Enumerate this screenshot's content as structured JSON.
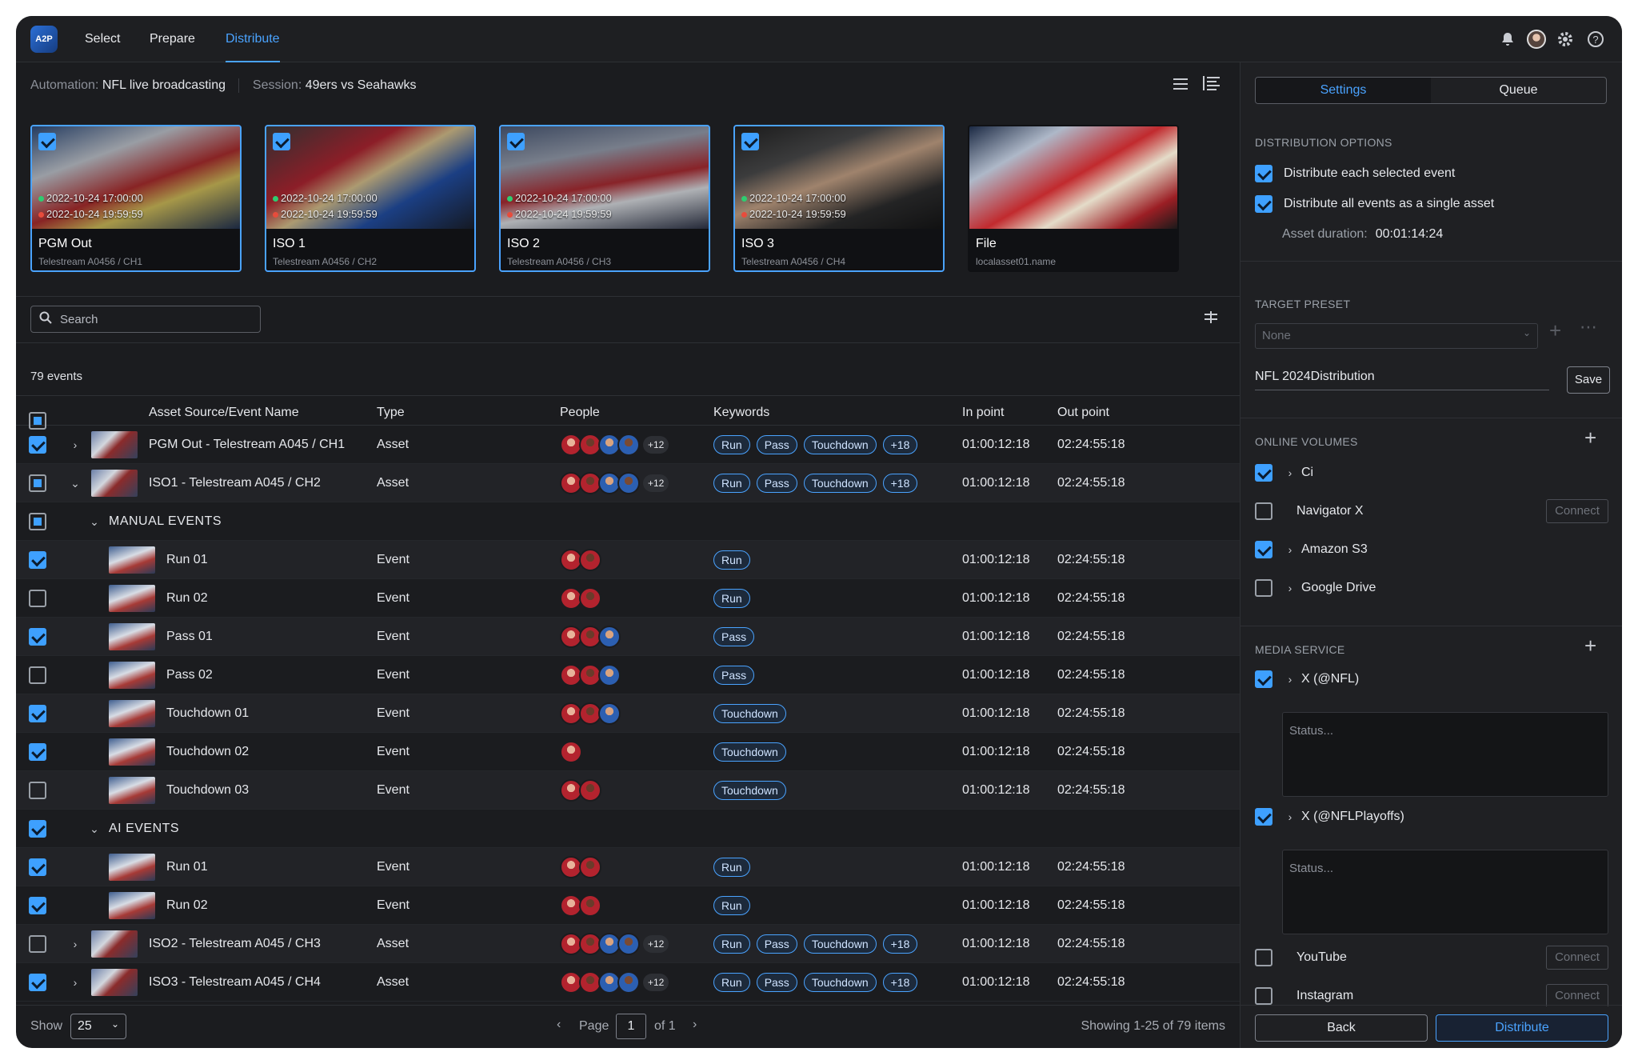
{
  "app": {
    "logo": "A2P",
    "tabs": [
      "Select",
      "Prepare",
      "Distribute"
    ],
    "active_tab": "Distribute"
  },
  "info": {
    "automation_label": "Automation:",
    "automation_value": "NFL live broadcasting",
    "session_label": "Session:",
    "session_value": "49ers vs Seahawks"
  },
  "cards": [
    {
      "name": "PGM Out",
      "sub": "Telestream A0456 / CH1",
      "start": "2022-10-24 17:00:00",
      "end": "2022-10-24 19:59:59",
      "checked": true
    },
    {
      "name": "ISO 1",
      "sub": "Telestream A0456 / CH2",
      "start": "2022-10-24 17:00:00",
      "end": "2022-10-24 19:59:59",
      "checked": true
    },
    {
      "name": "ISO 2",
      "sub": "Telestream A0456 / CH3",
      "start": "2022-10-24 17:00:00",
      "end": "2022-10-24 19:59:59",
      "checked": true
    },
    {
      "name": "ISO 3",
      "sub": "Telestream A0456 / CH4",
      "start": "2022-10-24 17:00:00",
      "end": "2022-10-24 19:59:59",
      "checked": true
    },
    {
      "name": "File",
      "sub": "localasset01.name",
      "start": "",
      "end": "",
      "checked": false
    }
  ],
  "search": {
    "placeholder": "Search"
  },
  "events_count": "79 events",
  "table": {
    "headers": [
      "Asset Source/Event Name",
      "Type",
      "People",
      "Keywords",
      "In point",
      "Out point"
    ],
    "rows": [
      {
        "kind": "asset",
        "checked": "on",
        "caret": "›",
        "name": "PGM Out - Telestream A045 / CH1",
        "type": "Asset",
        "people": 4,
        "more": "+12",
        "tags": [
          "Run",
          "Pass",
          "Touchdown",
          "+18"
        ],
        "in": "01:00:12:18",
        "out": "02:24:55:18"
      },
      {
        "kind": "asset",
        "checked": "ind",
        "caret": "⌄",
        "name": "ISO1 - Telestream A045 / CH2",
        "type": "Asset",
        "people": 4,
        "more": "+12",
        "tags": [
          "Run",
          "Pass",
          "Touchdown",
          "+18"
        ],
        "in": "01:00:12:18",
        "out": "02:24:55:18"
      },
      {
        "kind": "group",
        "checked": "ind",
        "caret": "⌄",
        "name": "MANUAL EVENTS"
      },
      {
        "kind": "event",
        "checked": "on",
        "name": "Run 01",
        "type": "Event",
        "people": 2,
        "tags": [
          "Run"
        ],
        "in": "01:00:12:18",
        "out": "02:24:55:18"
      },
      {
        "kind": "event",
        "checked": "off",
        "name": "Run 02",
        "type": "Event",
        "people": 2,
        "tags": [
          "Run"
        ],
        "in": "01:00:12:18",
        "out": "02:24:55:18"
      },
      {
        "kind": "event",
        "checked": "on",
        "name": "Pass 01",
        "type": "Event",
        "people": 3,
        "tags": [
          "Pass"
        ],
        "in": "01:00:12:18",
        "out": "02:24:55:18"
      },
      {
        "kind": "event",
        "checked": "off",
        "name": "Pass 02",
        "type": "Event",
        "people": 3,
        "tags": [
          "Pass"
        ],
        "in": "01:00:12:18",
        "out": "02:24:55:18"
      },
      {
        "kind": "event",
        "checked": "on",
        "name": "Touchdown 01",
        "type": "Event",
        "people": 3,
        "tags": [
          "Touchdown"
        ],
        "in": "01:00:12:18",
        "out": "02:24:55:18"
      },
      {
        "kind": "event",
        "checked": "on",
        "name": "Touchdown 02",
        "type": "Event",
        "people": 1,
        "tags": [
          "Touchdown"
        ],
        "in": "01:00:12:18",
        "out": "02:24:55:18"
      },
      {
        "kind": "event",
        "checked": "off",
        "name": "Touchdown 03",
        "type": "Event",
        "people": 2,
        "tags": [
          "Touchdown"
        ],
        "in": "01:00:12:18",
        "out": "02:24:55:18"
      },
      {
        "kind": "group",
        "checked": "on",
        "caret": "⌄",
        "name": "AI EVENTS"
      },
      {
        "kind": "event",
        "checked": "on",
        "name": "Run 01",
        "type": "Event",
        "people": 2,
        "tags": [
          "Run"
        ],
        "in": "01:00:12:18",
        "out": "02:24:55:18"
      },
      {
        "kind": "event",
        "checked": "on",
        "name": "Run 02",
        "type": "Event",
        "people": 2,
        "tags": [
          "Run"
        ],
        "in": "01:00:12:18",
        "out": "02:24:55:18"
      },
      {
        "kind": "asset",
        "checked": "off",
        "caret": "›",
        "name": "ISO2 - Telestream A045 / CH3",
        "type": "Asset",
        "people": 4,
        "more": "+12",
        "tags": [
          "Run",
          "Pass",
          "Touchdown",
          "+18"
        ],
        "in": "01:00:12:18",
        "out": "02:24:55:18"
      },
      {
        "kind": "asset",
        "checked": "on",
        "caret": "›",
        "name": "ISO3 - Telestream A045 / CH4",
        "type": "Asset",
        "people": 4,
        "more": "+12",
        "tags": [
          "Run",
          "Pass",
          "Touchdown",
          "+18"
        ],
        "in": "01:00:12:18",
        "out": "02:24:55:18"
      }
    ]
  },
  "footer": {
    "show_label": "Show",
    "page_size": "25",
    "page_label": "Page",
    "page": "1",
    "of": "of 1",
    "showing": "Showing 1-25 of 79 items"
  },
  "panel": {
    "tabs": [
      "Settings",
      "Queue"
    ],
    "active_tab": "Settings",
    "distribution_options": {
      "title": "DISTRIBUTION OPTIONS",
      "opt1": "Distribute each selected event",
      "opt2": "Distribute all events as a single asset",
      "duration_label": "Asset duration:",
      "duration_value": "00:01:14:24"
    },
    "target_preset": {
      "title": "TARGET PRESET",
      "dropdown": "None",
      "name_value": "NFL 2024Distribution",
      "save": "Save"
    },
    "online_volumes": {
      "title": "ONLINE VOLUMES",
      "items": [
        {
          "label": "Ci",
          "checked": true,
          "caret": true,
          "connect": ""
        },
        {
          "label": "Navigator X",
          "checked": false,
          "caret": false,
          "connect": "Connect"
        },
        {
          "label": "Amazon S3",
          "checked": true,
          "caret": true,
          "connect": ""
        },
        {
          "label": "Google Drive",
          "checked": false,
          "caret": true,
          "connect": ""
        }
      ]
    },
    "media_service": {
      "title": "MEDIA SERVICE",
      "x1": "X (@NFL)",
      "x2": "X (@NFLPlayoffs)",
      "status_placeholder": "Status...",
      "youtube": "YouTube",
      "instagram": "Instagram",
      "connect": "Connect"
    },
    "back": "Back",
    "distribute": "Distribute"
  },
  "colors": {
    "accent": "#4aa3ff",
    "background": "#1b1c1f",
    "panel": "#1f2023"
  }
}
